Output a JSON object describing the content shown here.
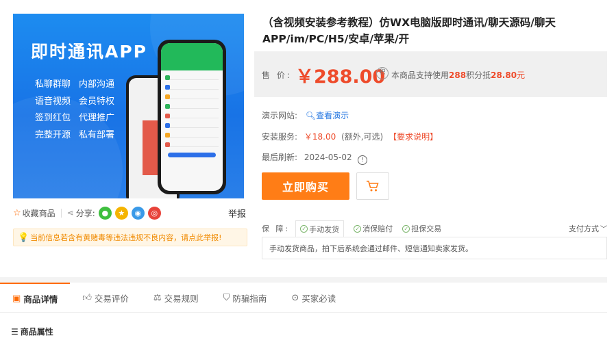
{
  "image": {
    "heading": "即时通讯APP",
    "features": [
      [
        "私聊群聊",
        "内部沟通"
      ],
      [
        "语音视频",
        "会员特权"
      ],
      [
        "签到红包",
        "代理推广"
      ],
      [
        "完整开源",
        "私有部署"
      ]
    ]
  },
  "share_bar": {
    "favorite_label": "收藏商品",
    "share_label": "分享:",
    "report_label": "举报",
    "icons": [
      "wechat-icon",
      "qzone-icon",
      "qq-icon",
      "weibo-icon"
    ]
  },
  "warning": "当前信息若含有黄赌毒等违法违规不良内容，请点此举报!",
  "product": {
    "title": "（含视频安装参考教程）仿WX电脑版即时通讯/聊天源码/聊天APP/im/PC/H5/安卓/苹果/开",
    "price_label": "售 价:",
    "price": "￥288.00",
    "points_icon": "积",
    "points_prefix": "本商品支持使用",
    "points_value": "288",
    "points_middle": "积分抵",
    "points_amount": "28.80",
    "points_suffix": "元",
    "demo_label": "演示网站:",
    "demo_link": "查看演示",
    "install_label": "安装服务:",
    "install_price": "￥18.00",
    "install_note": "(额外,可选)",
    "install_requirement": "【要求说明】",
    "refresh_label": "最后刷新:",
    "refresh_date": "2024-05-02"
  },
  "actions": {
    "buy_label": "立即购买"
  },
  "guarantee": {
    "label": "保 障:",
    "items": [
      "手动发货",
      "消保赔付",
      "担保交易"
    ],
    "pay_method": "支付方式",
    "note": "手动发货商品，拍下后系统会通过邮件、短信通知卖家发货。"
  },
  "tabs": [
    "商品详情",
    "交易评价",
    "交易规则",
    "防骗指南",
    "买家必读"
  ],
  "section": {
    "attributes_heading": "商品属性"
  },
  "colors": {
    "accent": "#ff7d16",
    "price": "#ee4b2b",
    "link": "#2a7ae2",
    "banner": "#1d8cf0"
  }
}
